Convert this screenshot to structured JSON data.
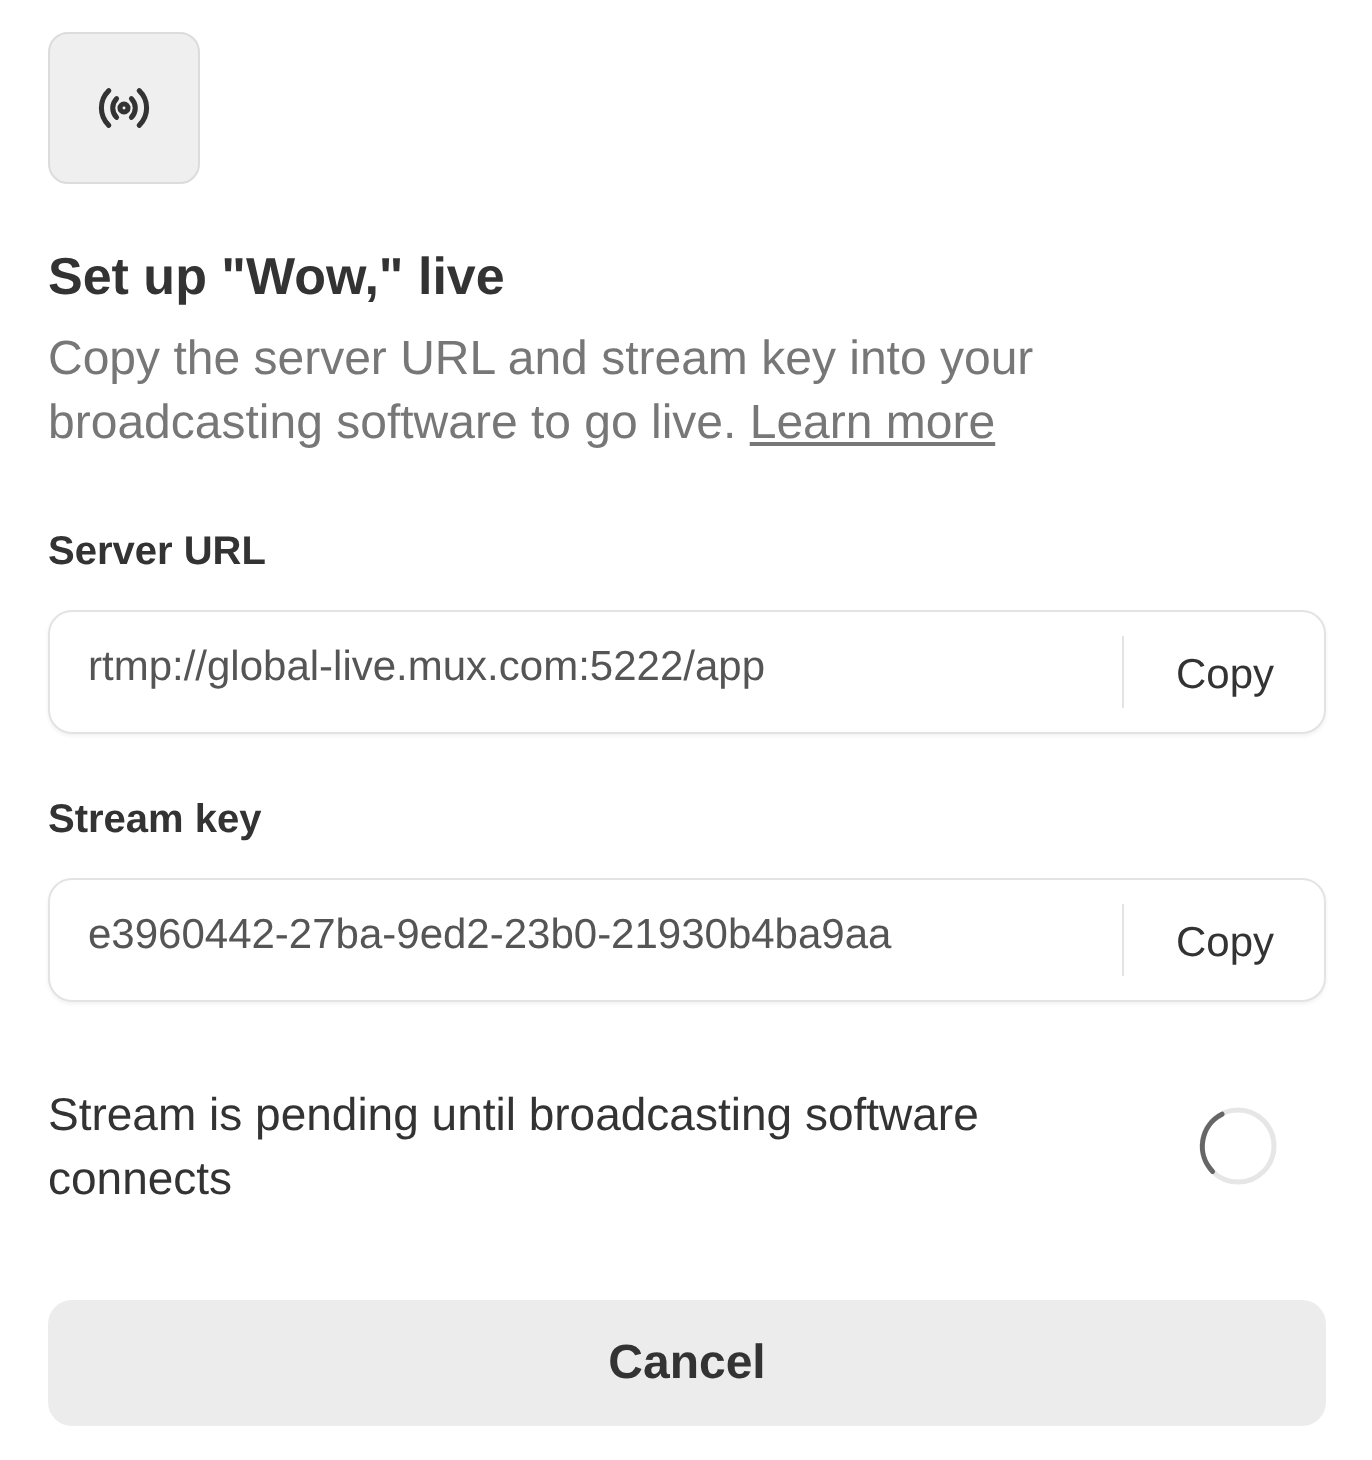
{
  "title": "Set up \"Wow,\" live",
  "description": {
    "text": "Copy the server URL and stream key into your broadcasting software to go live.",
    "link": "Learn more"
  },
  "fields": [
    {
      "label": "Server URL",
      "value": "rtmp://global-live.mux.com:5222/app",
      "button": "Copy"
    },
    {
      "label": "Stream key",
      "value": "e3960442-27ba-9ed2-23b0-21930b4ba9aa",
      "button": "Copy"
    }
  ],
  "status": {
    "text": "Stream is pending until broadcasting software connects",
    "pending": true
  },
  "buttons": [
    {
      "label": "Cancel"
    }
  ]
}
